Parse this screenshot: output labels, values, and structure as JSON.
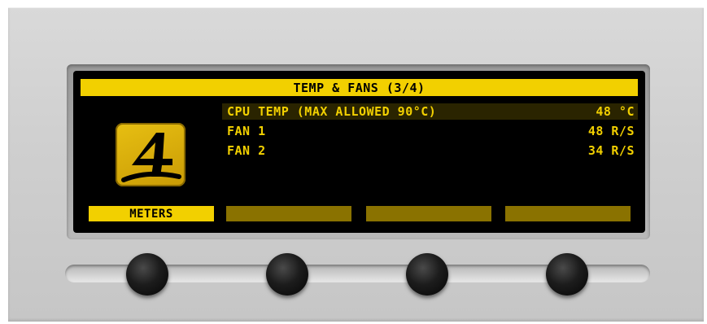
{
  "display": {
    "title": "TEMP & FANS (3/4)",
    "rows": [
      {
        "label": "CPU TEMP (MAX ALLOWED 90°C)",
        "value": "48 °C",
        "selected": true
      },
      {
        "label": "FAN 1",
        "value": "48 R/S",
        "selected": false
      },
      {
        "label": "FAN 2",
        "value": "34 R/S",
        "selected": false
      }
    ],
    "softkeys": [
      {
        "label": "METERS",
        "active": true
      },
      {
        "label": "",
        "active": false
      },
      {
        "label": "",
        "active": false
      },
      {
        "label": "",
        "active": false
      }
    ],
    "logo_glyph": "4"
  },
  "colors": {
    "accent": "#f2d000",
    "accent_dim": "#8a7200",
    "screen_bg": "#000000",
    "panel": "#d0d0d0"
  },
  "icons": [
    "logo-4-icon"
  ]
}
